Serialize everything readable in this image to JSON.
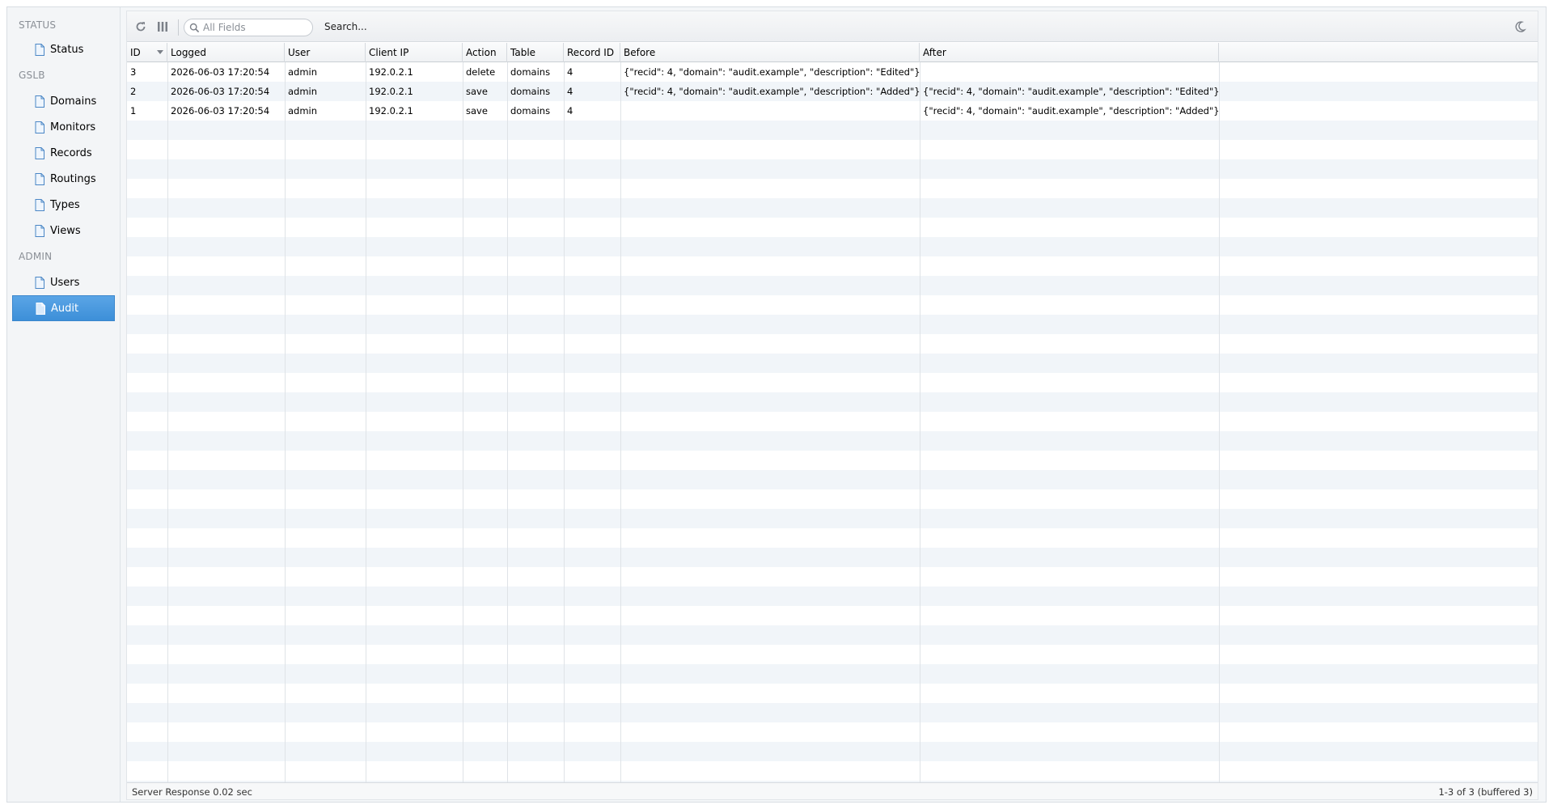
{
  "sidebar": {
    "groups": [
      {
        "label": "STATUS",
        "items": [
          "Status"
        ]
      },
      {
        "label": "GSLB",
        "items": [
          "Domains",
          "Monitors",
          "Records",
          "Routings",
          "Types",
          "Views"
        ]
      },
      {
        "label": "ADMIN",
        "items": [
          "Users",
          "Audit"
        ]
      }
    ],
    "active_item": "Audit"
  },
  "toolbar": {
    "search_placeholder": "All Fields",
    "search_label": "Search..."
  },
  "grid": {
    "columns": [
      "ID",
      "Logged",
      "User",
      "Client IP",
      "Action",
      "Table",
      "Record ID",
      "Before",
      "After"
    ],
    "sorted_column": "ID",
    "sort_direction": "desc",
    "rows": [
      {
        "id": "3",
        "logged": "2026-06-03 17:20:54",
        "user": "admin",
        "client_ip": "192.0.2.1",
        "action": "delete",
        "table": "domains",
        "record_id": "4",
        "before": "{\"recid\": 4, \"domain\": \"audit.example\", \"description\": \"Edited\"}",
        "after": ""
      },
      {
        "id": "2",
        "logged": "2026-06-03 17:20:54",
        "user": "admin",
        "client_ip": "192.0.2.1",
        "action": "save",
        "table": "domains",
        "record_id": "4",
        "before": "{\"recid\": 4, \"domain\": \"audit.example\", \"description\": \"Added\"}",
        "after": "{\"recid\": 4, \"domain\": \"audit.example\", \"description\": \"Edited\"}"
      },
      {
        "id": "1",
        "logged": "2026-06-03 17:20:54",
        "user": "admin",
        "client_ip": "192.0.2.1",
        "action": "save",
        "table": "domains",
        "record_id": "4",
        "before": "",
        "after": "{\"recid\": 4, \"domain\": \"audit.example\", \"description\": \"Added\"}"
      }
    ]
  },
  "statusbar": {
    "response": "Server Response 0.02 sec",
    "count": "1-3 of 3 (buffered 3)"
  },
  "colors": {
    "active_bg": "#4a99e0",
    "row_alt": "#f1f5f9",
    "sidebar_bg": "#f3f5f7"
  }
}
